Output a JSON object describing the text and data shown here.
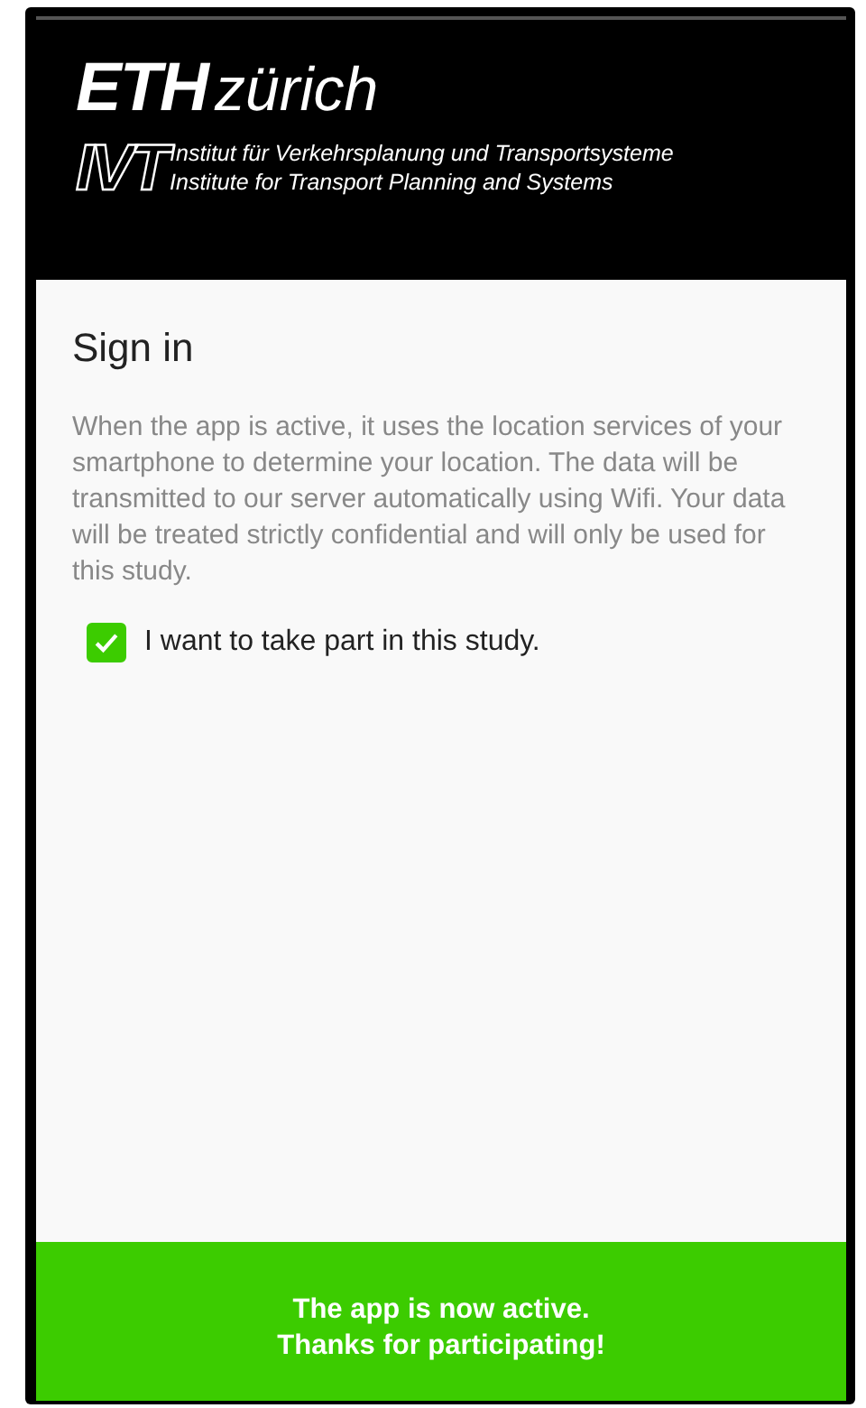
{
  "header": {
    "eth": "ETH",
    "city": "zürich",
    "ivt": "IVT",
    "institute_de": "Institut für Verkehrsplanung und Transportsysteme",
    "institute_en": "Institute for Transport Planning and Systems"
  },
  "title": "Sign in",
  "description": "When the app is active, it uses the location services of your smartphone to determine your location. The data will be transmitted to our server automatically using Wifi. Your data will be treated strictly confidential and will only be used for this study.",
  "consent": {
    "label": "I want to take part in this study.",
    "checked": true
  },
  "status_bar": {
    "message": "The app is now active.\nThanks for participating!"
  }
}
